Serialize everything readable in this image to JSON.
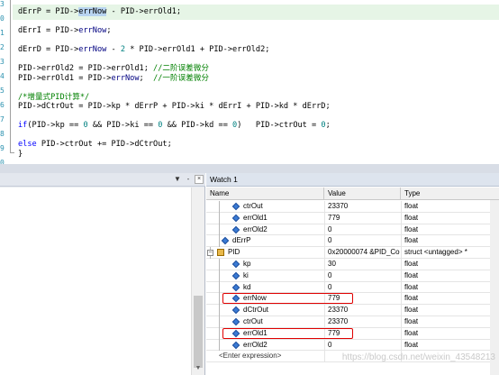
{
  "editor": {
    "line_numbers": [
      "3",
      "0",
      "1",
      "2",
      "3",
      "4",
      "5",
      "6",
      "7",
      "8",
      "9",
      "0",
      "1"
    ],
    "lines": [
      {
        "segments": [
          {
            "t": "dErrP = PID->",
            "c": "plain"
          },
          {
            "t": "errNow",
            "c": "hl"
          },
          {
            "t": " - PID->errOld1;",
            "c": "plain"
          }
        ]
      },
      {
        "segments": []
      },
      {
        "segments": [
          {
            "t": "dErrI = PID->",
            "c": "plain"
          },
          {
            "t": "errNow",
            "c": "ident"
          },
          {
            "t": ";",
            "c": "plain"
          }
        ]
      },
      {
        "segments": []
      },
      {
        "segments": [
          {
            "t": "dErrD = PID->",
            "c": "plain"
          },
          {
            "t": "errNow",
            "c": "ident"
          },
          {
            "t": " - ",
            "c": "plain"
          },
          {
            "t": "2",
            "c": "num"
          },
          {
            "t": " * PID->errOld1 + PID->errOld2;",
            "c": "plain"
          }
        ]
      },
      {
        "segments": []
      },
      {
        "segments": [
          {
            "t": "PID->errOld2 = PID->errOld1; ",
            "c": "plain"
          },
          {
            "t": "//二阶误差微分",
            "c": "cm"
          }
        ]
      },
      {
        "segments": [
          {
            "t": "PID->errOld1 = PID->",
            "c": "plain"
          },
          {
            "t": "errNow",
            "c": "ident"
          },
          {
            "t": ";  ",
            "c": "plain"
          },
          {
            "t": "//一阶误差微分",
            "c": "cm"
          }
        ]
      },
      {
        "segments": []
      },
      {
        "segments": [
          {
            "t": "/*增量式PID计算*/",
            "c": "cm"
          }
        ]
      },
      {
        "segments": [
          {
            "t": "PID->dCtrOut = PID->kp * dErrP + PID->ki * dErrI + PID->kd * dErrD;",
            "c": "plain"
          }
        ]
      },
      {
        "segments": []
      },
      {
        "segments": [
          {
            "t": "if",
            "c": "kw"
          },
          {
            "t": "(PID->kp == ",
            "c": "plain"
          },
          {
            "t": "0",
            "c": "num"
          },
          {
            "t": " && PID->ki == ",
            "c": "plain"
          },
          {
            "t": "0",
            "c": "num"
          },
          {
            "t": " && PID->kd == ",
            "c": "plain"
          },
          {
            "t": "0",
            "c": "num"
          },
          {
            "t": ")   PID->ctrOut = ",
            "c": "plain"
          },
          {
            "t": "0",
            "c": "num"
          },
          {
            "t": ";",
            "c": "plain"
          }
        ]
      },
      {
        "segments": []
      },
      {
        "segments": [
          {
            "t": "else",
            "c": "kw"
          },
          {
            "t": " PID->ctrOut += PID->dCtrOut;",
            "c": "plain"
          }
        ]
      },
      {
        "segments": [
          {
            "t": "}",
            "c": "plain"
          }
        ]
      }
    ]
  },
  "left_pane": {
    "pin_label": "▼",
    "pin2_label": "‑",
    "close_label": "×"
  },
  "watch": {
    "title": "Watch 1",
    "columns": {
      "name": "Name",
      "value": "Value",
      "type": "Type"
    },
    "rows": [
      {
        "name": "ctrOut",
        "value": "23370",
        "type": "float",
        "level": 2,
        "kind": "leaf",
        "boxed": false
      },
      {
        "name": "errOld1",
        "value": "779",
        "type": "float",
        "level": 2,
        "kind": "leaf",
        "boxed": false
      },
      {
        "name": "errOld2",
        "value": "0",
        "type": "float",
        "level": 2,
        "kind": "leaf",
        "boxed": false
      },
      {
        "name": "dErrP",
        "value": "0",
        "type": "float",
        "level": 1,
        "kind": "leaf",
        "boxed": false
      },
      {
        "name": "PID",
        "value": "0x20000074 &PID_Con...",
        "type": "struct <untagged> *",
        "level": 0,
        "kind": "struct",
        "expander": "−",
        "boxed": false
      },
      {
        "name": "kp",
        "value": "30",
        "type": "float",
        "level": 2,
        "kind": "leaf",
        "boxed": false
      },
      {
        "name": "ki",
        "value": "0",
        "type": "float",
        "level": 2,
        "kind": "leaf",
        "boxed": false
      },
      {
        "name": "kd",
        "value": "0",
        "type": "float",
        "level": 2,
        "kind": "leaf",
        "boxed": false
      },
      {
        "name": "errNow",
        "value": "779",
        "type": "float",
        "level": 2,
        "kind": "leaf",
        "boxed": true
      },
      {
        "name": "dCtrOut",
        "value": "23370",
        "type": "float",
        "level": 2,
        "kind": "leaf",
        "boxed": false
      },
      {
        "name": "ctrOut",
        "value": "23370",
        "type": "float",
        "level": 2,
        "kind": "leaf",
        "boxed": false
      },
      {
        "name": "errOld1",
        "value": "779",
        "type": "float",
        "level": 2,
        "kind": "leaf",
        "boxed": true
      },
      {
        "name": "errOld2",
        "value": "0",
        "type": "float",
        "level": 2,
        "kind": "leaf",
        "boxed": false
      },
      {
        "name": "<Enter expression>",
        "value": "",
        "type": "",
        "level": 0,
        "kind": "placeholder",
        "boxed": false
      }
    ]
  },
  "watermark": "https://blog.csdn.net/weixin_43548213",
  "colors": {
    "keyword": "#0000ff",
    "number": "#008080",
    "comment": "#008000",
    "current_line": "#e6f5e6",
    "highlight_box": "#e00000",
    "variable_icon": "#3a7bd5"
  }
}
